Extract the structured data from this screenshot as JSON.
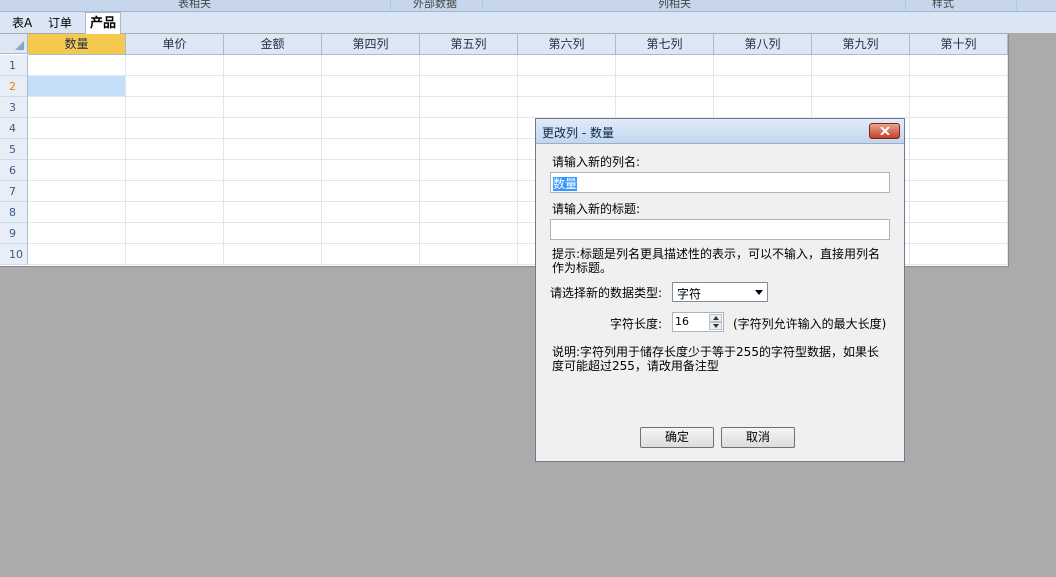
{
  "ribbon_groups": [
    "表相关",
    "外部数据",
    "列相关",
    "样式"
  ],
  "tabs": [
    {
      "label": "表A",
      "active": false
    },
    {
      "label": "订单",
      "active": false
    },
    {
      "label": "产品",
      "active": true
    }
  ],
  "grid": {
    "columns": [
      "数量",
      "单价",
      "金额",
      "第四列",
      "第五列",
      "第六列",
      "第七列",
      "第八列",
      "第九列",
      "第十列"
    ],
    "rows": [
      "1",
      "2",
      "3",
      "4",
      "5",
      "6",
      "7",
      "8",
      "9",
      "10"
    ],
    "selected_column": 0,
    "active_row": 1,
    "colors": {
      "selected_header": "#f5c94f",
      "active_cell": "#c5dffb",
      "header_bg": "#dde7f4"
    }
  },
  "dialog": {
    "title": "更改列 - 数量",
    "column_name_label": "请输入新的列名:",
    "column_name_value": "数量",
    "caption_label": "请输入新的标题:",
    "caption_value": "",
    "hint": "提示:标题是列名更具描述性的表示，可以不输入，直接用列名作为标题。",
    "type_label": "请选择新的数据类型:",
    "type_value": "字符",
    "length_label": "字符长度:",
    "length_value": "16",
    "length_note": "(字符列允许输入的最大长度)",
    "description": "说明:字符列用于储存长度少于等于255的字符型数据，如果长度可能超过255，请改用备注型",
    "ok_label": "确定",
    "cancel_label": "取消"
  }
}
